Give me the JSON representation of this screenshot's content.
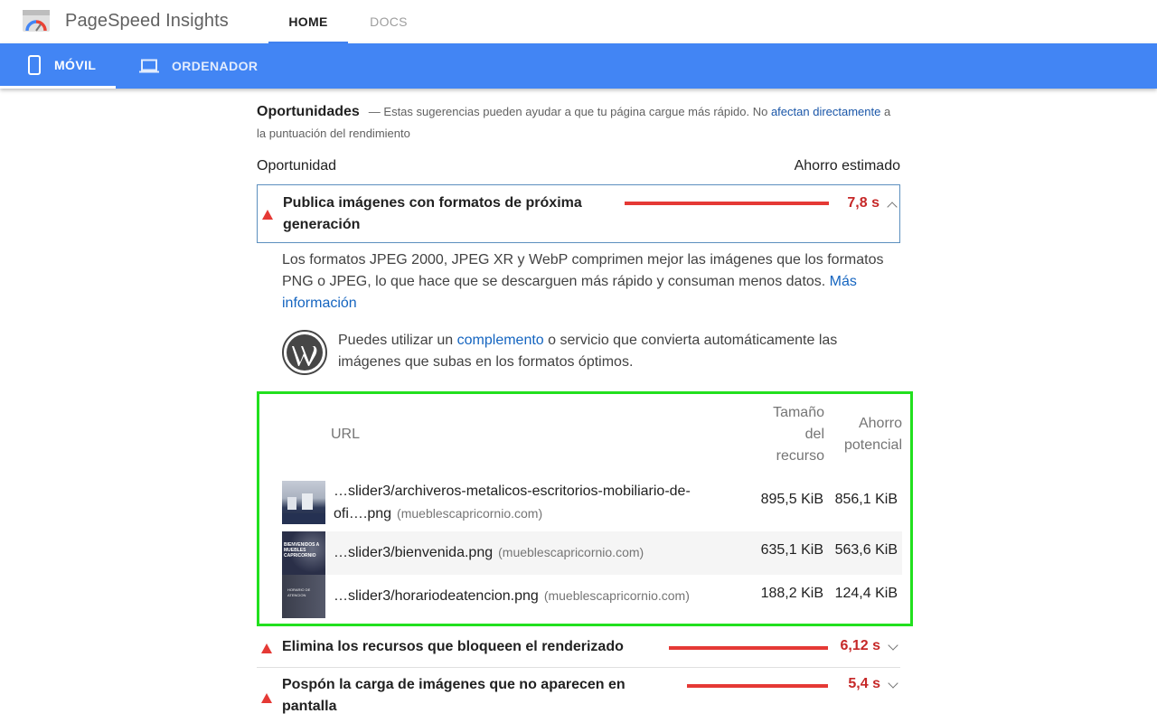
{
  "header": {
    "app_title": "PageSpeed Insights",
    "nav": [
      {
        "label": "HOME",
        "active": true
      },
      {
        "label": "DOCS",
        "active": false
      }
    ]
  },
  "device_tabs": [
    {
      "label": "MÓVIL",
      "icon": "phone-icon",
      "active": true
    },
    {
      "label": "ORDENADOR",
      "icon": "laptop-icon",
      "active": false
    }
  ],
  "opportunities": {
    "title": "Oportunidades",
    "subtitle_before": "— Estas sugerencias pueden ayudar a que tu página cargue más rápido. No ",
    "subtitle_link": "afectan directamente",
    "subtitle_after": " a la puntuación del rendimiento",
    "col_opportunity": "Oportunidad",
    "col_savings": "Ahorro estimado"
  },
  "audits": [
    {
      "title": "Publica imágenes con formatos de próxima generación",
      "savings": "7,8 s",
      "expanded": true,
      "description_text": "Los formatos JPEG 2000, JPEG XR y WebP comprimen mejor las imágenes que los formatos PNG o JPEG, lo que hace que se descarguen más rápido y consuman menos datos. ",
      "description_link": "Más información",
      "wp_tip_before": "Puedes utilizar un ",
      "wp_tip_link": "complemento",
      "wp_tip_after": " o servicio que convierta automáticamente las imágenes que subas en los formatos óptimos.",
      "table": {
        "col_url": "URL",
        "col_size": "Tamaño del recurso",
        "col_savings": "Ahorro potencial",
        "rows": [
          {
            "url": "…slider3/archiveros-metalicos-escritorios-mobiliario-de-ofi….png",
            "host": "(mueblescapricornio.com)",
            "size": "895,5 KiB",
            "savings": "856,1 KiB"
          },
          {
            "url": "…slider3/bienvenida.png",
            "host": "(mueblescapricornio.com)",
            "size": "635,1 KiB",
            "savings": "563,6 KiB"
          },
          {
            "url": "…slider3/horariodeatencion.png",
            "host": "(mueblescapricornio.com)",
            "size": "188,2 KiB",
            "savings": "124,4 KiB"
          }
        ]
      }
    },
    {
      "title": "Elimina los recursos que bloqueen el renderizado",
      "savings": "6,12 s",
      "expanded": false
    },
    {
      "title": "Pospón la carga de imágenes que no aparecen en pantalla",
      "savings": "5,4 s",
      "expanded": false
    }
  ],
  "thumb_text": {
    "bienvenida_line1": "BIENVENIDOS A",
    "bienvenida_line2": "MUEBLES",
    "bienvenida_line3": "CAPRICORNIO",
    "horario_line1": "HORARIO DE",
    "horario_line2": "ATENCION"
  },
  "colors": {
    "accent_blue": "#4285f4",
    "fail_red": "#e53935",
    "highlight_green": "#22e01e"
  }
}
